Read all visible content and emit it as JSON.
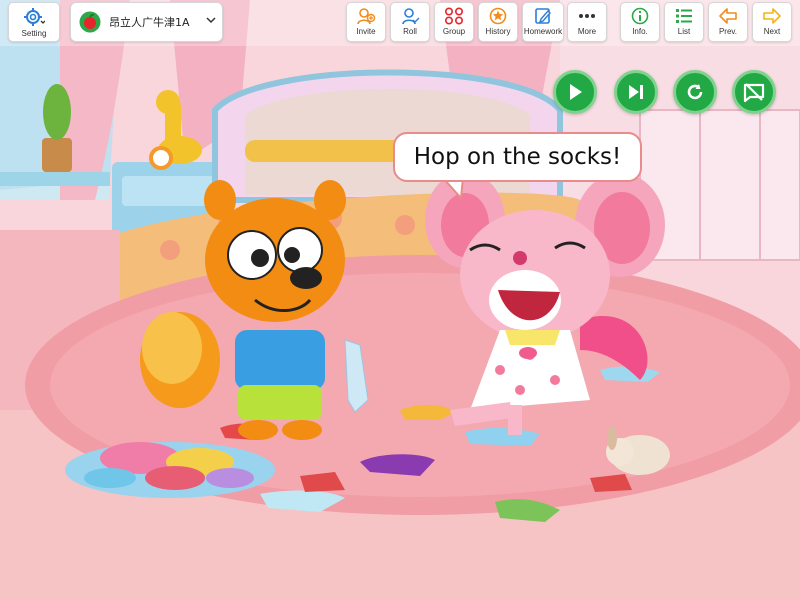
{
  "toolbar": {
    "setting": {
      "label": "Setting",
      "icon": "gear-icon"
    },
    "class_selector": {
      "name": "昂立人广牛津1A",
      "icon": "apple-icon"
    },
    "right_buttons": [
      {
        "id": "invite",
        "label": "Invite",
        "icon": "invite-icon"
      },
      {
        "id": "roll",
        "label": "Roll",
        "icon": "roll-icon"
      },
      {
        "id": "group",
        "label": "Group",
        "icon": "group-icon"
      },
      {
        "id": "history",
        "label": "History",
        "icon": "history-icon"
      },
      {
        "id": "homework",
        "label": "Homework",
        "icon": "homework-icon"
      },
      {
        "id": "more",
        "label": "More",
        "icon": "more-icon"
      },
      {
        "id": "info",
        "label": "Info.",
        "icon": "info-icon"
      },
      {
        "id": "list",
        "label": "List",
        "icon": "list-icon"
      },
      {
        "id": "prev",
        "label": "Prev.",
        "icon": "prev-arrow-icon"
      },
      {
        "id": "next",
        "label": "Next",
        "icon": "next-arrow-icon"
      }
    ]
  },
  "playback": [
    "play-icon",
    "skip-next-icon",
    "replay-icon",
    "hide-subtitle-icon"
  ],
  "speech": {
    "text": "Hop on the socks!"
  },
  "colors": {
    "red_accent": "#e6262b",
    "blue_accent": "#2a7fd6",
    "orange_accent": "#f28c1b",
    "green_accent": "#2aa84a",
    "yellow_accent": "#f3b21b",
    "playback_green": "#22a845"
  }
}
